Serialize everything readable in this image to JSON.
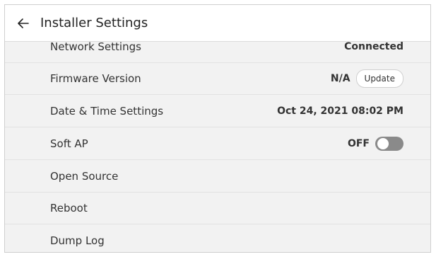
{
  "header": {
    "back_icon": "arrow-left-icon",
    "title": "Installer Settings"
  },
  "rows": [
    {
      "label": "Network Settings",
      "value": "Connected"
    },
    {
      "label": "Firmware Version",
      "value": "N/A",
      "button": "Update"
    },
    {
      "label": "Date & Time Settings",
      "value": "Oct 24, 2021 08:02 PM"
    },
    {
      "label": "Soft AP",
      "value": "OFF",
      "toggle_on": false
    },
    {
      "label": "Open Source"
    },
    {
      "label": "Reboot"
    },
    {
      "label": "Dump Log"
    }
  ],
  "colors": {
    "background": "#f2f2f2",
    "header": "#ffffff",
    "toggle_off": "#8a8a8a"
  }
}
